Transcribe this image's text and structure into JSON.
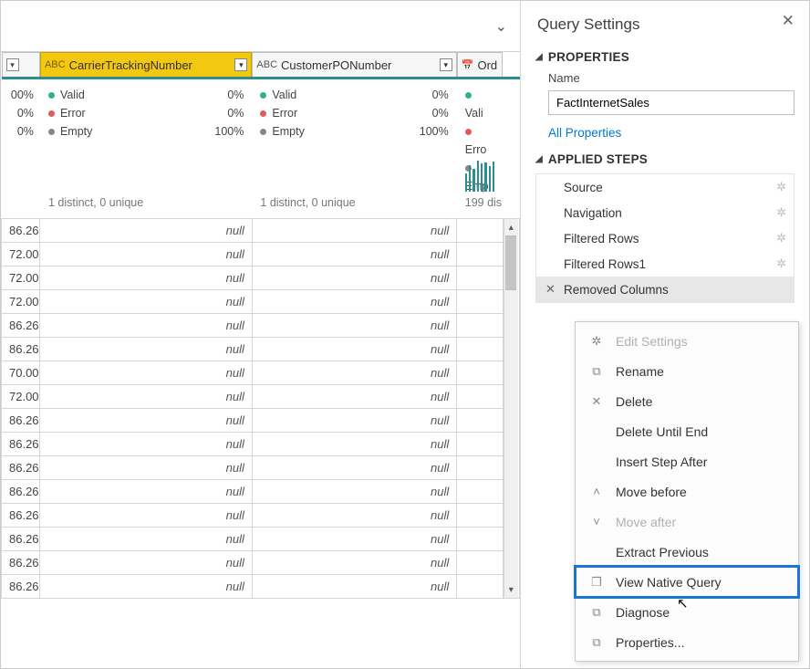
{
  "columns": [
    {
      "id": "carrier",
      "type": "ABC",
      "label": "CarrierTrackingNumber",
      "selected": true,
      "profile": {
        "valid": "0%",
        "error": "0%",
        "empty": "100%"
      },
      "distinct": "1 distinct, 0 unique"
    },
    {
      "id": "custpo",
      "type": "ABC",
      "label": "CustomerPONumber",
      "selected": false,
      "profile": {
        "valid": "0%",
        "error": "0%",
        "empty": "100%"
      },
      "distinct": "1 distinct, 0 unique"
    },
    {
      "id": "ord",
      "type": "",
      "label": "Ord",
      "selected": false,
      "profile": {
        "valid": "Vali",
        "error": "Erro",
        "empty": "Emp"
      },
      "distinct": "199 dis"
    }
  ],
  "col0_stats": {
    "a": "00%",
    "b": "0%",
    "c": "0%"
  },
  "profile_labels": {
    "valid": "Valid",
    "error": "Error",
    "empty": "Empty"
  },
  "rows": [
    {
      "v": "86.26"
    },
    {
      "v": "72.00"
    },
    {
      "v": "72.00"
    },
    {
      "v": "72.00"
    },
    {
      "v": "86.26"
    },
    {
      "v": "86.26"
    },
    {
      "v": "70.00"
    },
    {
      "v": "72.00"
    },
    {
      "v": "86.26"
    },
    {
      "v": "86.26"
    },
    {
      "v": "86.26"
    },
    {
      "v": "86.26"
    },
    {
      "v": "86.26"
    },
    {
      "v": "86.26"
    },
    {
      "v": "86.26"
    },
    {
      "v": "86.26"
    }
  ],
  "null_text": "null",
  "panel": {
    "title": "Query Settings",
    "properties_hdr": "PROPERTIES",
    "name_label": "Name",
    "name_value": "FactInternetSales",
    "all_props": "All Properties",
    "steps_hdr": "APPLIED STEPS",
    "steps": [
      {
        "label": "Source",
        "gear": true
      },
      {
        "label": "Navigation",
        "gear": true
      },
      {
        "label": "Filtered Rows",
        "gear": true
      },
      {
        "label": "Filtered Rows1",
        "gear": true
      },
      {
        "label": "Removed Columns",
        "gear": false,
        "selected": true
      }
    ]
  },
  "context_menu": [
    {
      "label": "Edit Settings",
      "icon": "✲",
      "disabled": true
    },
    {
      "label": "Rename",
      "icon": "⧉"
    },
    {
      "label": "Delete",
      "icon": "✕"
    },
    {
      "label": "Delete Until End"
    },
    {
      "label": "Insert Step After"
    },
    {
      "label": "Move before",
      "icon": "˄"
    },
    {
      "label": "Move after",
      "icon": "˅",
      "disabled": true
    },
    {
      "label": "Extract Previous"
    },
    {
      "label": "View Native Query",
      "icon": "❐",
      "highlight": true
    },
    {
      "label": "Diagnose",
      "icon": "⧉"
    },
    {
      "label": "Properties...",
      "icon": "⧉"
    }
  ]
}
